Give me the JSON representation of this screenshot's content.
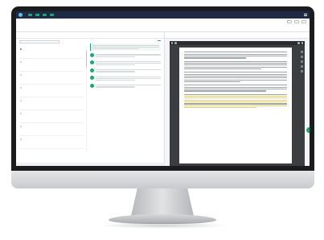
{
  "topbar": {
    "nav": [
      {
        "label": "",
        "badge": true
      },
      {
        "label": "",
        "badge": true
      },
      {
        "label": "",
        "badge": true
      },
      {
        "label": "",
        "badge": true
      }
    ]
  },
  "header": {
    "page_title": "",
    "subtitle": "",
    "buttons": [
      "",
      "",
      ""
    ]
  },
  "tabs": [
    "",
    "",
    "",
    ""
  ],
  "list": {
    "items": [
      {
        "name": "",
        "meta": "",
        "active": true
      },
      {
        "name": "",
        "meta": "",
        "active": false
      },
      {
        "name": "",
        "meta": "",
        "active": false
      },
      {
        "name": "",
        "meta": "",
        "active": false
      },
      {
        "name": "",
        "meta": "",
        "active": false
      },
      {
        "name": "",
        "meta": "",
        "active": false
      },
      {
        "name": "",
        "meta": "",
        "active": false
      },
      {
        "name": "",
        "meta": "",
        "active": false
      }
    ]
  },
  "viewer": {
    "page_number": ""
  },
  "colors": {
    "accent": "#19a974",
    "topbar": "#1f2a44",
    "viewer_bg": "#3b3d41",
    "highlight": "#e7d36a"
  },
  "icons": {
    "logo": "logo-icon",
    "menu": "menu-icon",
    "search": "search-icon",
    "comment": "comment-icon",
    "fab": "add-icon"
  }
}
